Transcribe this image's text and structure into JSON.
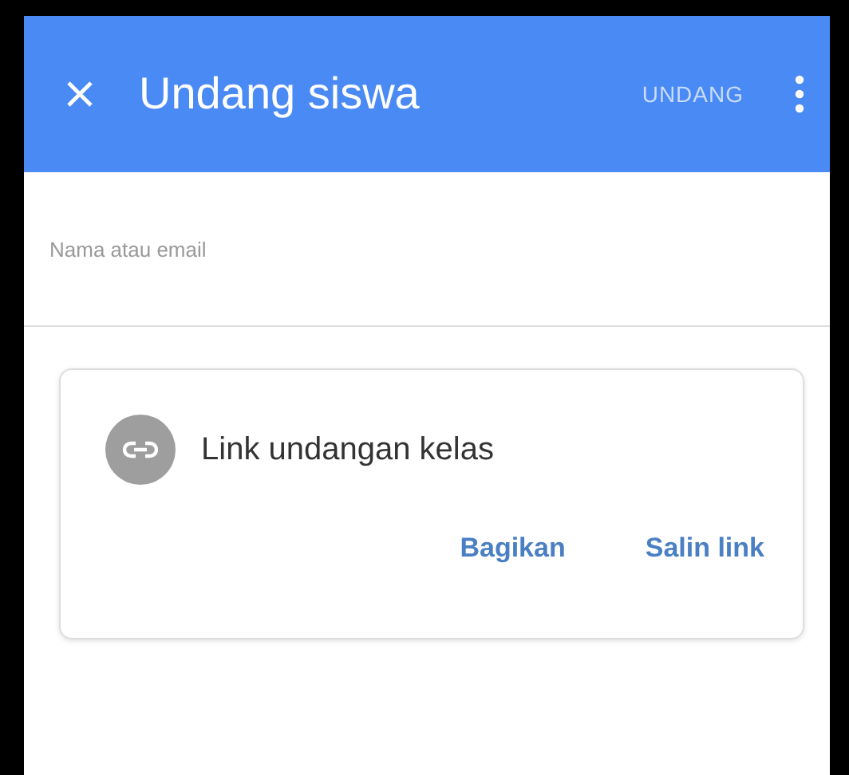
{
  "app_bar": {
    "title": "Undang siswa",
    "action": {
      "label": "UNDANG",
      "disabled": true
    }
  },
  "field": {
    "placeholder": "Nama atau email"
  },
  "invite_card": {
    "title": "Link undangan kelas",
    "buttons": [
      "Bagikan",
      "Salin link"
    ]
  }
}
